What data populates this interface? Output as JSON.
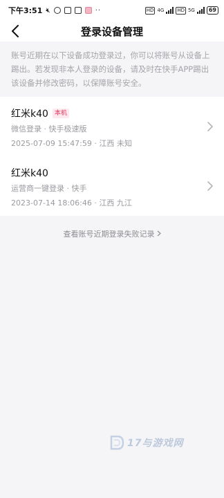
{
  "status_bar": {
    "time": "下午3:51",
    "battery": "69",
    "net_4g": "4G",
    "net_5g": "5G",
    "hd_1": "HD",
    "hd_2": "HD"
  },
  "nav": {
    "title": "登录设备管理"
  },
  "notice": {
    "text": "账号近期在以下设备成功登录过，你可以将账号从设备上踢出。若发现非本人登录的设备，请及时在快手APP踢出该设备并修改密码，以保障账号安全。"
  },
  "devices": [
    {
      "name": "红米k40",
      "badge": "本机",
      "meta": "微信登录 · 快手极速版",
      "time": "2025-07-09 15:47:59 · 江西 未知"
    },
    {
      "name": "红米k40",
      "badge": "",
      "meta": "运营商一键登录 · 快手",
      "time": "2023-07-14 18:06:46 · 江西 九江"
    }
  ],
  "failed_link": {
    "label": "查看账号近期登录失败记录"
  },
  "watermark": {
    "text": "17与游戏网"
  }
}
